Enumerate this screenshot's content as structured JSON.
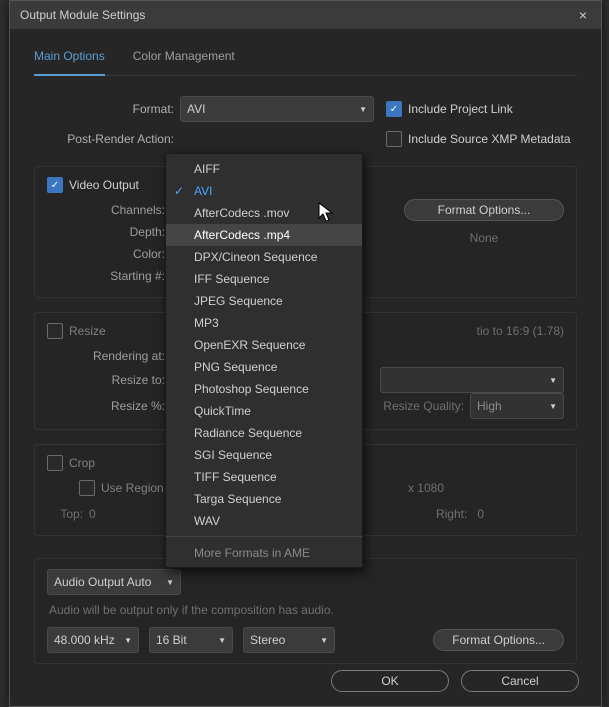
{
  "dialog": {
    "title": "Output Module Settings",
    "close_label": "×"
  },
  "tabs": {
    "main": "Main Options",
    "color": "Color Management"
  },
  "format": {
    "label": "Format:",
    "value": "AVI",
    "include_project_link": "Include Project Link",
    "post_render_label": "Post-Render Action:",
    "include_xmp": "Include Source XMP Metadata",
    "format_options_btn": "Format Options...",
    "options": [
      "AIFF",
      "AVI",
      "AfterCodecs .mov",
      "AfterCodecs .mp4",
      "DPX/Cineon Sequence",
      "IFF Sequence",
      "JPEG Sequence",
      "MP3",
      "OpenEXR Sequence",
      "PNG Sequence",
      "Photoshop Sequence",
      "QuickTime",
      "Radiance Sequence",
      "SGI Sequence",
      "TIFF Sequence",
      "Targa Sequence",
      "WAV"
    ],
    "more_in_ame": "More Formats in AME"
  },
  "video": {
    "title": "Video Output",
    "channels_label": "Channels:",
    "depth_label": "Depth:",
    "color_label": "Color:",
    "starting_label": "Starting #:",
    "none": "None"
  },
  "resize": {
    "title": "Resize",
    "lock_aspect": "tio to 16:9 (1.78)",
    "rendering_at": "Rendering at:",
    "resize_to": "Resize to:",
    "resize_pct": "Resize %:",
    "quality_label": "Resize Quality:",
    "quality_value": "High"
  },
  "crop": {
    "title": "Crop",
    "use_region": "Use Region",
    "dims_tail": "x 1080",
    "top": "Top:",
    "top_v": "0",
    "right": "Right:",
    "right_v": "0"
  },
  "audio": {
    "output_mode": "Audio Output Auto",
    "note": "Audio will be output only if the composition has audio.",
    "rate": "48.000 kHz",
    "depth": "16 Bit",
    "channels": "Stereo",
    "format_options_btn": "Format Options..."
  },
  "buttons": {
    "ok": "OK",
    "cancel": "Cancel"
  }
}
